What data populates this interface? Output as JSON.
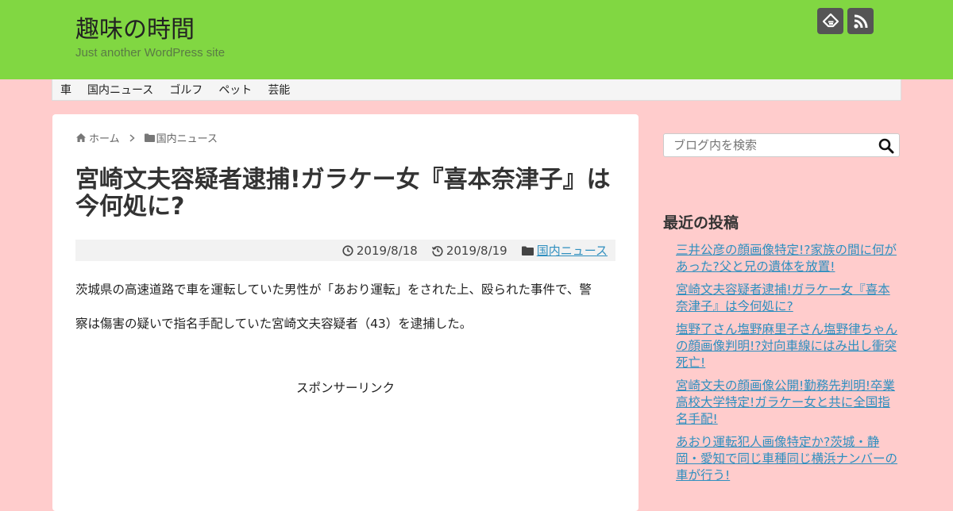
{
  "site": {
    "title": "趣味の時間",
    "description": "Just another WordPress site"
  },
  "header_icons": [
    {
      "name": "feedly-icon"
    },
    {
      "name": "rss-icon"
    }
  ],
  "nav": {
    "items": [
      "車",
      "国内ニュース",
      "ゴルフ",
      "ペット",
      "芸能"
    ]
  },
  "breadcrumb": {
    "home": "ホーム",
    "category": "国内ニュース"
  },
  "post": {
    "title": "宮崎文夫容疑者逮捕!ガラケー女『喜本奈津子』は今何処に?",
    "published": "2019/8/18",
    "updated": "2019/8/19",
    "category": "国内ニュース",
    "body_line1": "茨城県の高速道路で車を運転していた男性が「あおり運転」をされた上、殴られた事件で、警",
    "body_line2": "察は傷害の疑いで指名手配していた宮崎文夫容疑者（43）を逮捕した。",
    "sponsor": "スポンサーリンク"
  },
  "sidebar": {
    "search_placeholder": "ブログ内を検索",
    "recent_title": "最近の投稿",
    "recent_posts": [
      "三井公彦の顔画像特定!?家族の間に何があった?父と兄の遺体を放置!",
      "宮崎文夫容疑者逮捕!ガラケー女『喜本奈津子』は今何処に?",
      "塩野了さん塩野麻里子さん塩野律ちゃんの顔画像判明!?対向車線にはみ出し衝突死亡!",
      "宮崎文夫の顔画像公開!勤務先判明!卒業高校大学特定!ガラケー女と共に全国指名手配!",
      "あおり運転犯人画像特定か?茨城・静岡・愛知で同じ車種同じ横浜ナンバーの車が行う!"
    ]
  },
  "colors": {
    "header_bg": "#81d742",
    "page_bg": "#ffcccc",
    "link": "#2f8fbf"
  }
}
